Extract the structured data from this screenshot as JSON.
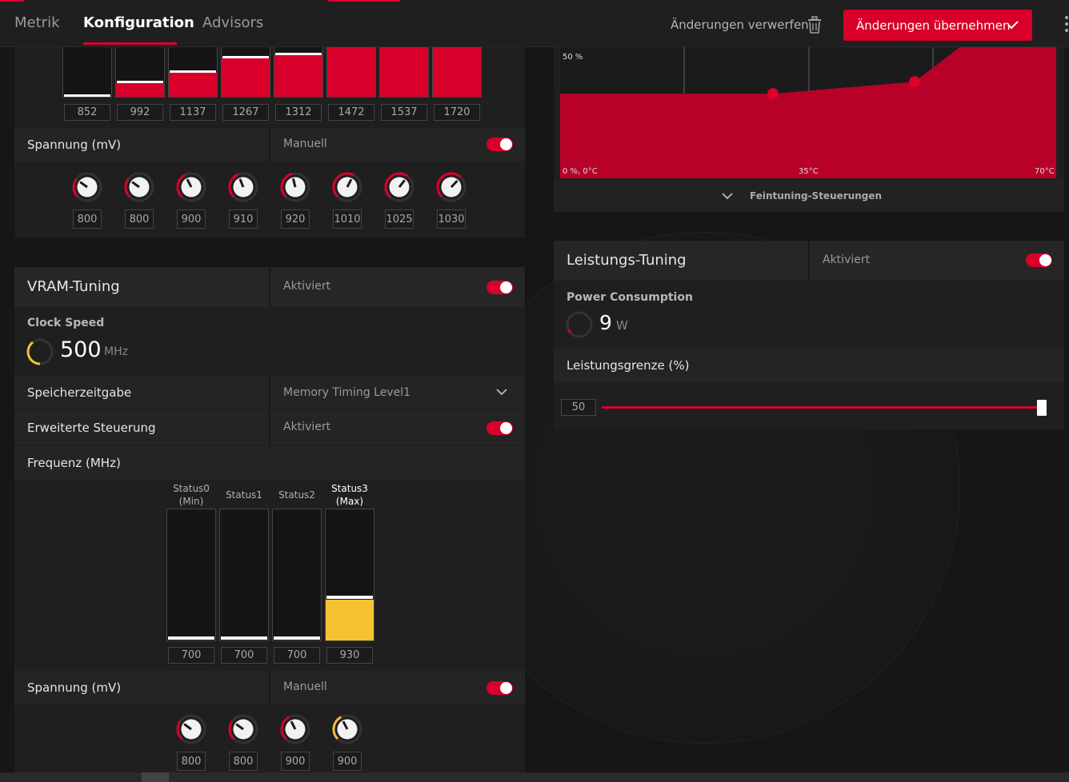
{
  "tabs": [
    {
      "label": "Metrik",
      "active": false
    },
    {
      "label": "Konfiguration",
      "active": true
    },
    {
      "label": "Advisors",
      "active": false
    }
  ],
  "toolbar": {
    "discard_label": "Änderungen verwerfen",
    "apply_label": "Änderungen übernehmen"
  },
  "colors": {
    "accent": "#d8002a",
    "yellow": "#f5c232"
  },
  "gpu_bars": {
    "values": [
      "852",
      "992",
      "1137",
      "1267",
      "1312",
      "1472",
      "1537",
      "1720"
    ],
    "fill_fraction": [
      0.0,
      0.28,
      0.5,
      0.78,
      0.85,
      1.0,
      1.0,
      1.0
    ]
  },
  "gpu_voltage": {
    "label": "Spannung (mV)",
    "mode": "Manuell",
    "knobs": [
      "800",
      "800",
      "900",
      "910",
      "920",
      "1010",
      "1025",
      "1030"
    ],
    "knob_level": [
      0.3,
      0.3,
      0.4,
      0.42,
      0.45,
      0.6,
      0.64,
      0.66
    ]
  },
  "fan_chart": {
    "y_top_label": "50 %",
    "x_labels": [
      "0 %, 0°C",
      "35°C",
      "70°C"
    ],
    "points_pct": [
      35,
      40,
      58,
      65,
      72
    ],
    "fine_tuning_label": "Feintuning-Steuerungen"
  },
  "vram": {
    "title": "VRAM-Tuning",
    "status": "Aktiviert",
    "clock_label": "Clock Speed",
    "clock_value": "500",
    "clock_unit": "MHz",
    "timing_label": "Speicherzeitgabe",
    "timing_value": "Memory Timing Level1",
    "advanced_label": "Erweiterte Steuerung",
    "advanced_value": "Aktiviert",
    "freq_label": "Frequenz (MHz)",
    "states": [
      {
        "label_line1": "Status0",
        "label_line2": "(Min)",
        "value": "700",
        "fill": 0.0
      },
      {
        "label_line1": "Status1",
        "label_line2": "",
        "value": "700",
        "fill": 0.0
      },
      {
        "label_line1": "Status2",
        "label_line2": "",
        "value": "700",
        "fill": 0.0
      },
      {
        "label_line1": "Status3",
        "label_line2": "(Max)",
        "value": "930",
        "fill": 0.31
      }
    ],
    "voltage_label": "Spannung (mV)",
    "voltage_mode": "Manuell",
    "voltage_knobs": [
      "800",
      "800",
      "900",
      "900"
    ],
    "voltage_level": [
      0.3,
      0.3,
      0.4,
      0.4
    ]
  },
  "power": {
    "title": "Leistungs-Tuning",
    "status": "Aktiviert",
    "consumption_label": "Power Consumption",
    "consumption_value": "9",
    "consumption_unit": "W",
    "limit_label": "Leistungsgrenze (%)",
    "limit_value": "50",
    "limit_fraction": 1.0
  }
}
